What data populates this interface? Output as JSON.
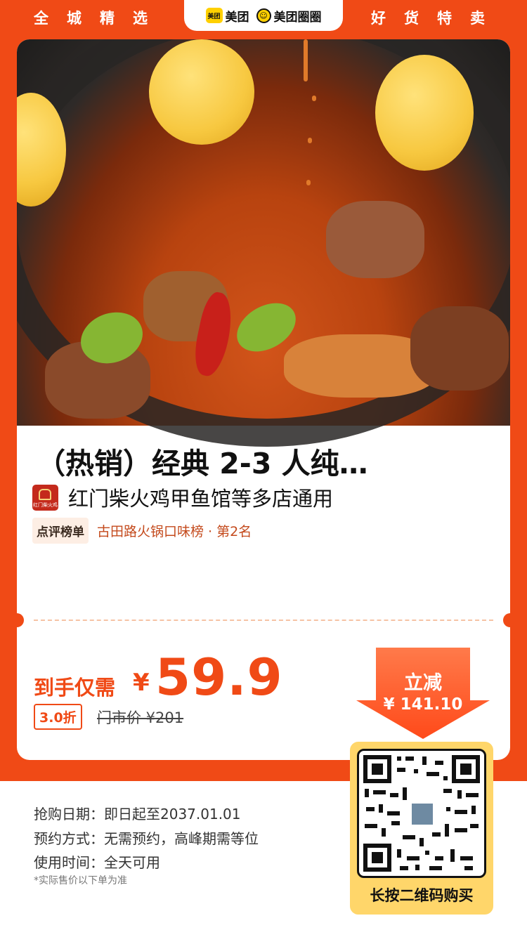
{
  "header": {
    "left_text": "全城精选",
    "right_text": "好货特卖",
    "brand_meituan": "美团",
    "brand_meituan_logo": "美团",
    "brand_circle": "美团圈圈",
    "brand_circle_logo": "☺"
  },
  "product": {
    "title": "（热销）经典 2-3 人纯…",
    "shop_name": "红门柴火鸡甲鱼馆等多店通用",
    "shop_logo_text": "红门柴火鸡",
    "rank_badge": "点评榜单",
    "rank_text": "古田路火锅口味榜 · 第2名"
  },
  "price": {
    "label": "到手仅需",
    "currency": "¥",
    "amount": "59.9",
    "discount": "3.0折",
    "original": "门市价 ¥201",
    "save_label": "立减",
    "save_amount": "¥ 141.10"
  },
  "details": {
    "date": "抢购日期：即日起至2037.01.01",
    "booking": "预约方式：无需预约，高峰期需等位",
    "usage": "使用时间：全天可用",
    "note": "*实际售价以下单为准"
  },
  "qr": {
    "caption": "长按二维码购买"
  },
  "colors": {
    "brand_orange": "#f04a16",
    "yellow": "#ffd000"
  }
}
